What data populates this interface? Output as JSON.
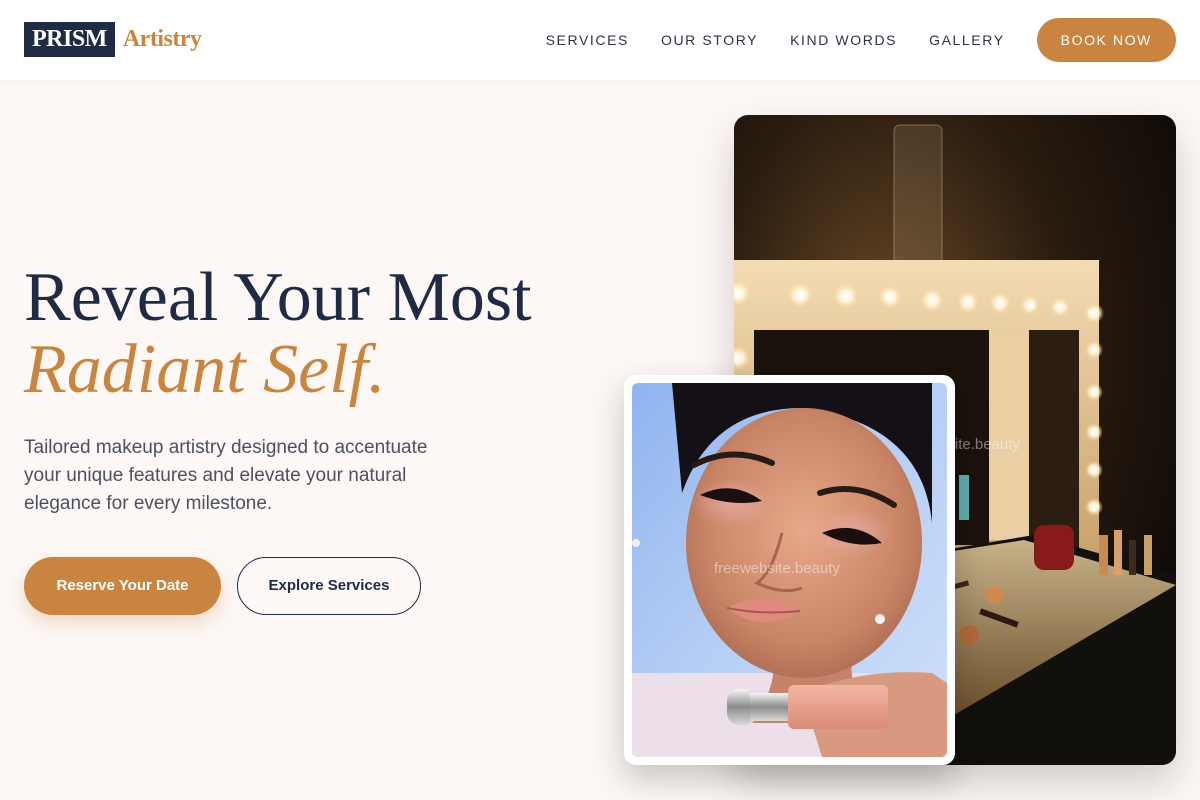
{
  "header": {
    "logo_box": "PRISM",
    "logo_text": "Artistry",
    "nav": [
      "SERVICES",
      "OUR STORY",
      "KIND WORDS",
      "GALLERY"
    ],
    "cta": "BOOK NOW"
  },
  "hero": {
    "title_line1": "Reveal Your Most",
    "title_line2": "Radiant Self.",
    "subtitle": "Tailored makeup artistry designed to accentuate your unique features and elevate your natural elegance for every milestone.",
    "primary_button": "Reserve Your Date",
    "secondary_button": "Explore Services"
  },
  "images": {
    "main_alt": "Makeup vanity mirror with lights",
    "portrait_alt": "Model with pink eyeshadow holding a blush stick",
    "watermark": "freewebsite.beauty"
  },
  "colors": {
    "navy": "#1f2a44",
    "accent": "#c9853f",
    "background": "#fdf8f6"
  }
}
